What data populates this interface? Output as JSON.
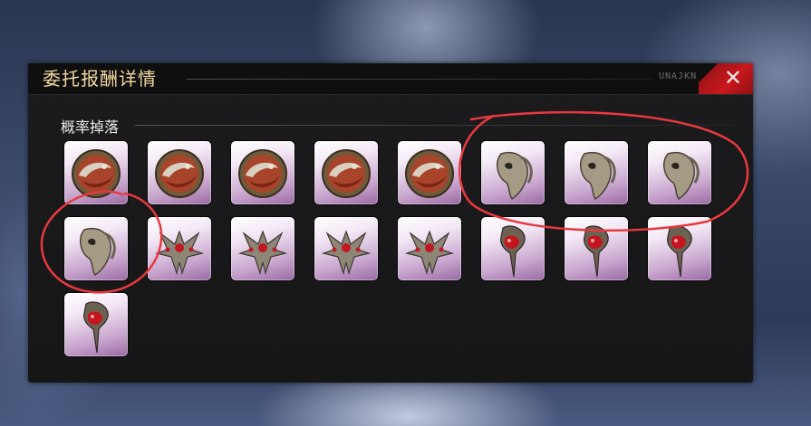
{
  "dialog": {
    "title": "委托报酬详情",
    "code": "UNAJKN",
    "close_label": "✕"
  },
  "section": {
    "title": "概率掉落"
  },
  "items": [
    {
      "icon": "crimson-emblem-icon"
    },
    {
      "icon": "crimson-emblem-icon"
    },
    {
      "icon": "crimson-emblem-icon"
    },
    {
      "icon": "crimson-emblem-icon"
    },
    {
      "icon": "crimson-emblem-icon"
    },
    {
      "icon": "silver-mask-icon"
    },
    {
      "icon": "silver-mask-icon"
    },
    {
      "icon": "silver-mask-icon"
    },
    {
      "icon": "silver-mask-icon"
    },
    {
      "icon": "spiked-crown-icon"
    },
    {
      "icon": "spiked-crown-icon"
    },
    {
      "icon": "spiked-crown-icon"
    },
    {
      "icon": "spiked-crown-icon"
    },
    {
      "icon": "ruby-pendant-icon"
    },
    {
      "icon": "ruby-pendant-icon"
    },
    {
      "icon": "ruby-pendant-icon"
    },
    {
      "icon": "ruby-pendant-icon"
    }
  ],
  "colors": {
    "title": "#f1d9a0",
    "close_accent": "#c8181c",
    "annotation": "#e8383f"
  }
}
